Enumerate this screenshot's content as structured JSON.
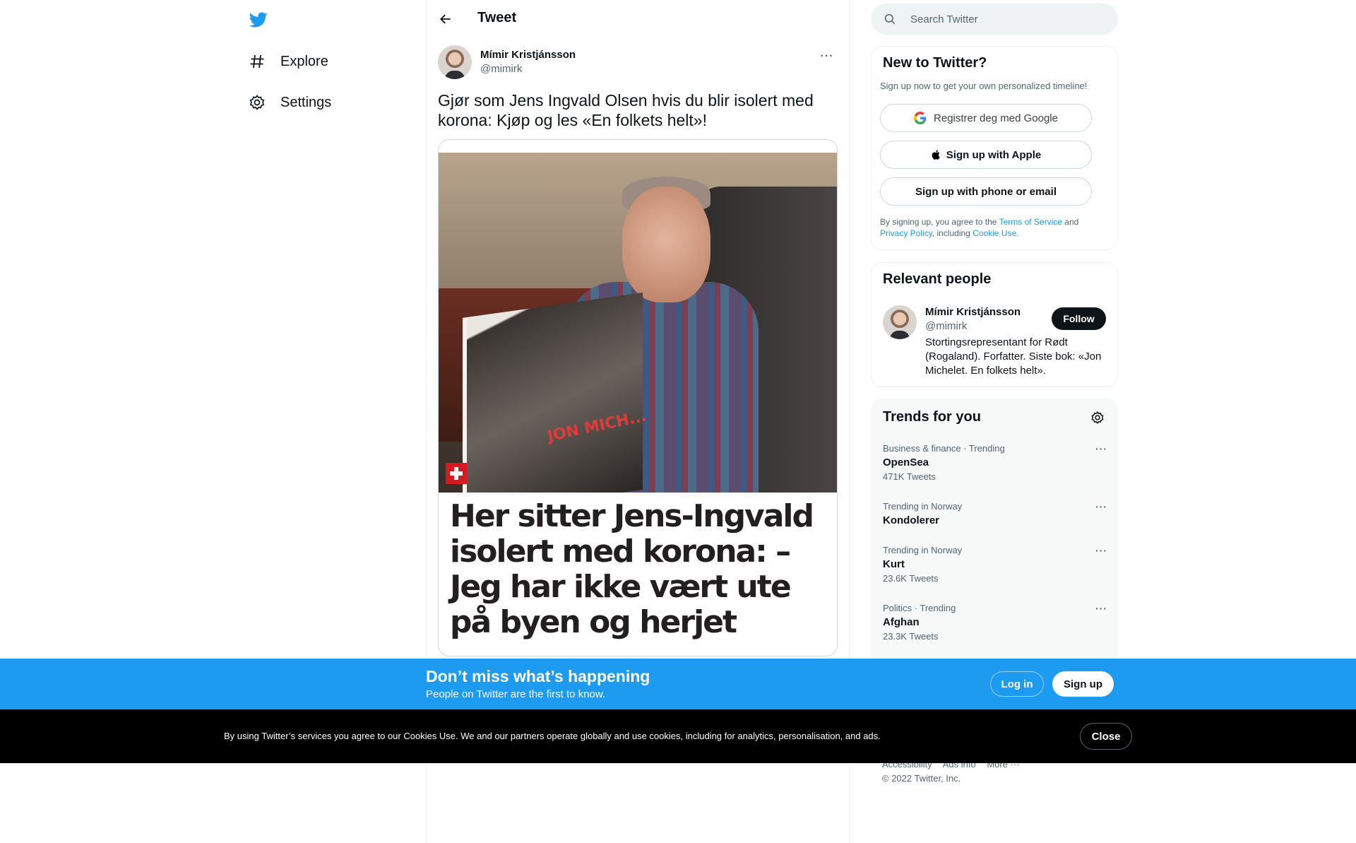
{
  "nav": {
    "items": [
      {
        "label": "Explore",
        "icon": "hashtag-icon"
      },
      {
        "label": "Settings",
        "icon": "gear-icon"
      }
    ]
  },
  "header": {
    "title": "Tweet"
  },
  "tweet": {
    "author_name": "Mímir Kristjánsson",
    "author_handle": "@mimirk",
    "text": "Gjør som Jens Ingvald Olsen hvis du blir isolert med korona: Kjøp og les «En folkets helt»!",
    "media": {
      "book_cover_text": "JON MICH...",
      "headline": "Her sitter Jens-Ingvald isolert med korona: – Jeg har ikke vært ute på byen og herjet"
    }
  },
  "search": {
    "placeholder": "Search Twitter"
  },
  "new_to_twitter": {
    "title": "New to Twitter?",
    "subtitle": "Sign up now to get your own personalized timeline!",
    "google_label": "Registrer deg med Google",
    "apple_label": "Sign up with Apple",
    "phone_label": "Sign up with phone or email",
    "legal_prefix": "By signing up, you agree to the",
    "terms_link": "Terms of Service",
    "legal_and": "and",
    "privacy_link": "Privacy Policy",
    "legal_including": ", including",
    "cookie_link": "Cookie Use."
  },
  "relevant_people": {
    "title": "Relevant people",
    "name": "Mímir Kristjánsson",
    "handle": "@mimirk",
    "follow_label": "Follow",
    "bio": "Stortingsrepresentant for Rødt (Rogaland). Forfatter. Siste bok: «Jon Michelet. En folkets helt»."
  },
  "trends": {
    "title": "Trends for you",
    "items": [
      {
        "meta": "Business & finance · Trending",
        "name": "OpenSea",
        "count": "471K Tweets"
      },
      {
        "meta": "Trending in Norway",
        "name": "Kondolerer",
        "count": ""
      },
      {
        "meta": "Trending in Norway",
        "name": "Kurt",
        "count": "23.6K Tweets"
      },
      {
        "meta": "Politics · Trending",
        "name": "Afghan",
        "count": "23.3K Tweets"
      }
    ]
  },
  "footer": {
    "links": [
      "Accessibility",
      "Ads info",
      "More ···"
    ],
    "copyright": "© 2022 Twitter, Inc."
  },
  "banner": {
    "title": "Don’t miss what’s happening",
    "subtitle": "People on Twitter are the first to know.",
    "login_label": "Log in",
    "signup_label": "Sign up"
  },
  "cookie": {
    "text": "By using Twitter’s services you agree to our Cookies Use. We and our partners operate globally and use cookies, including for analytics, personalisation, and ads.",
    "close_label": "Close"
  },
  "colors": {
    "accent": "#1d9bf0",
    "text": "#0f1419",
    "muted": "#536471"
  }
}
